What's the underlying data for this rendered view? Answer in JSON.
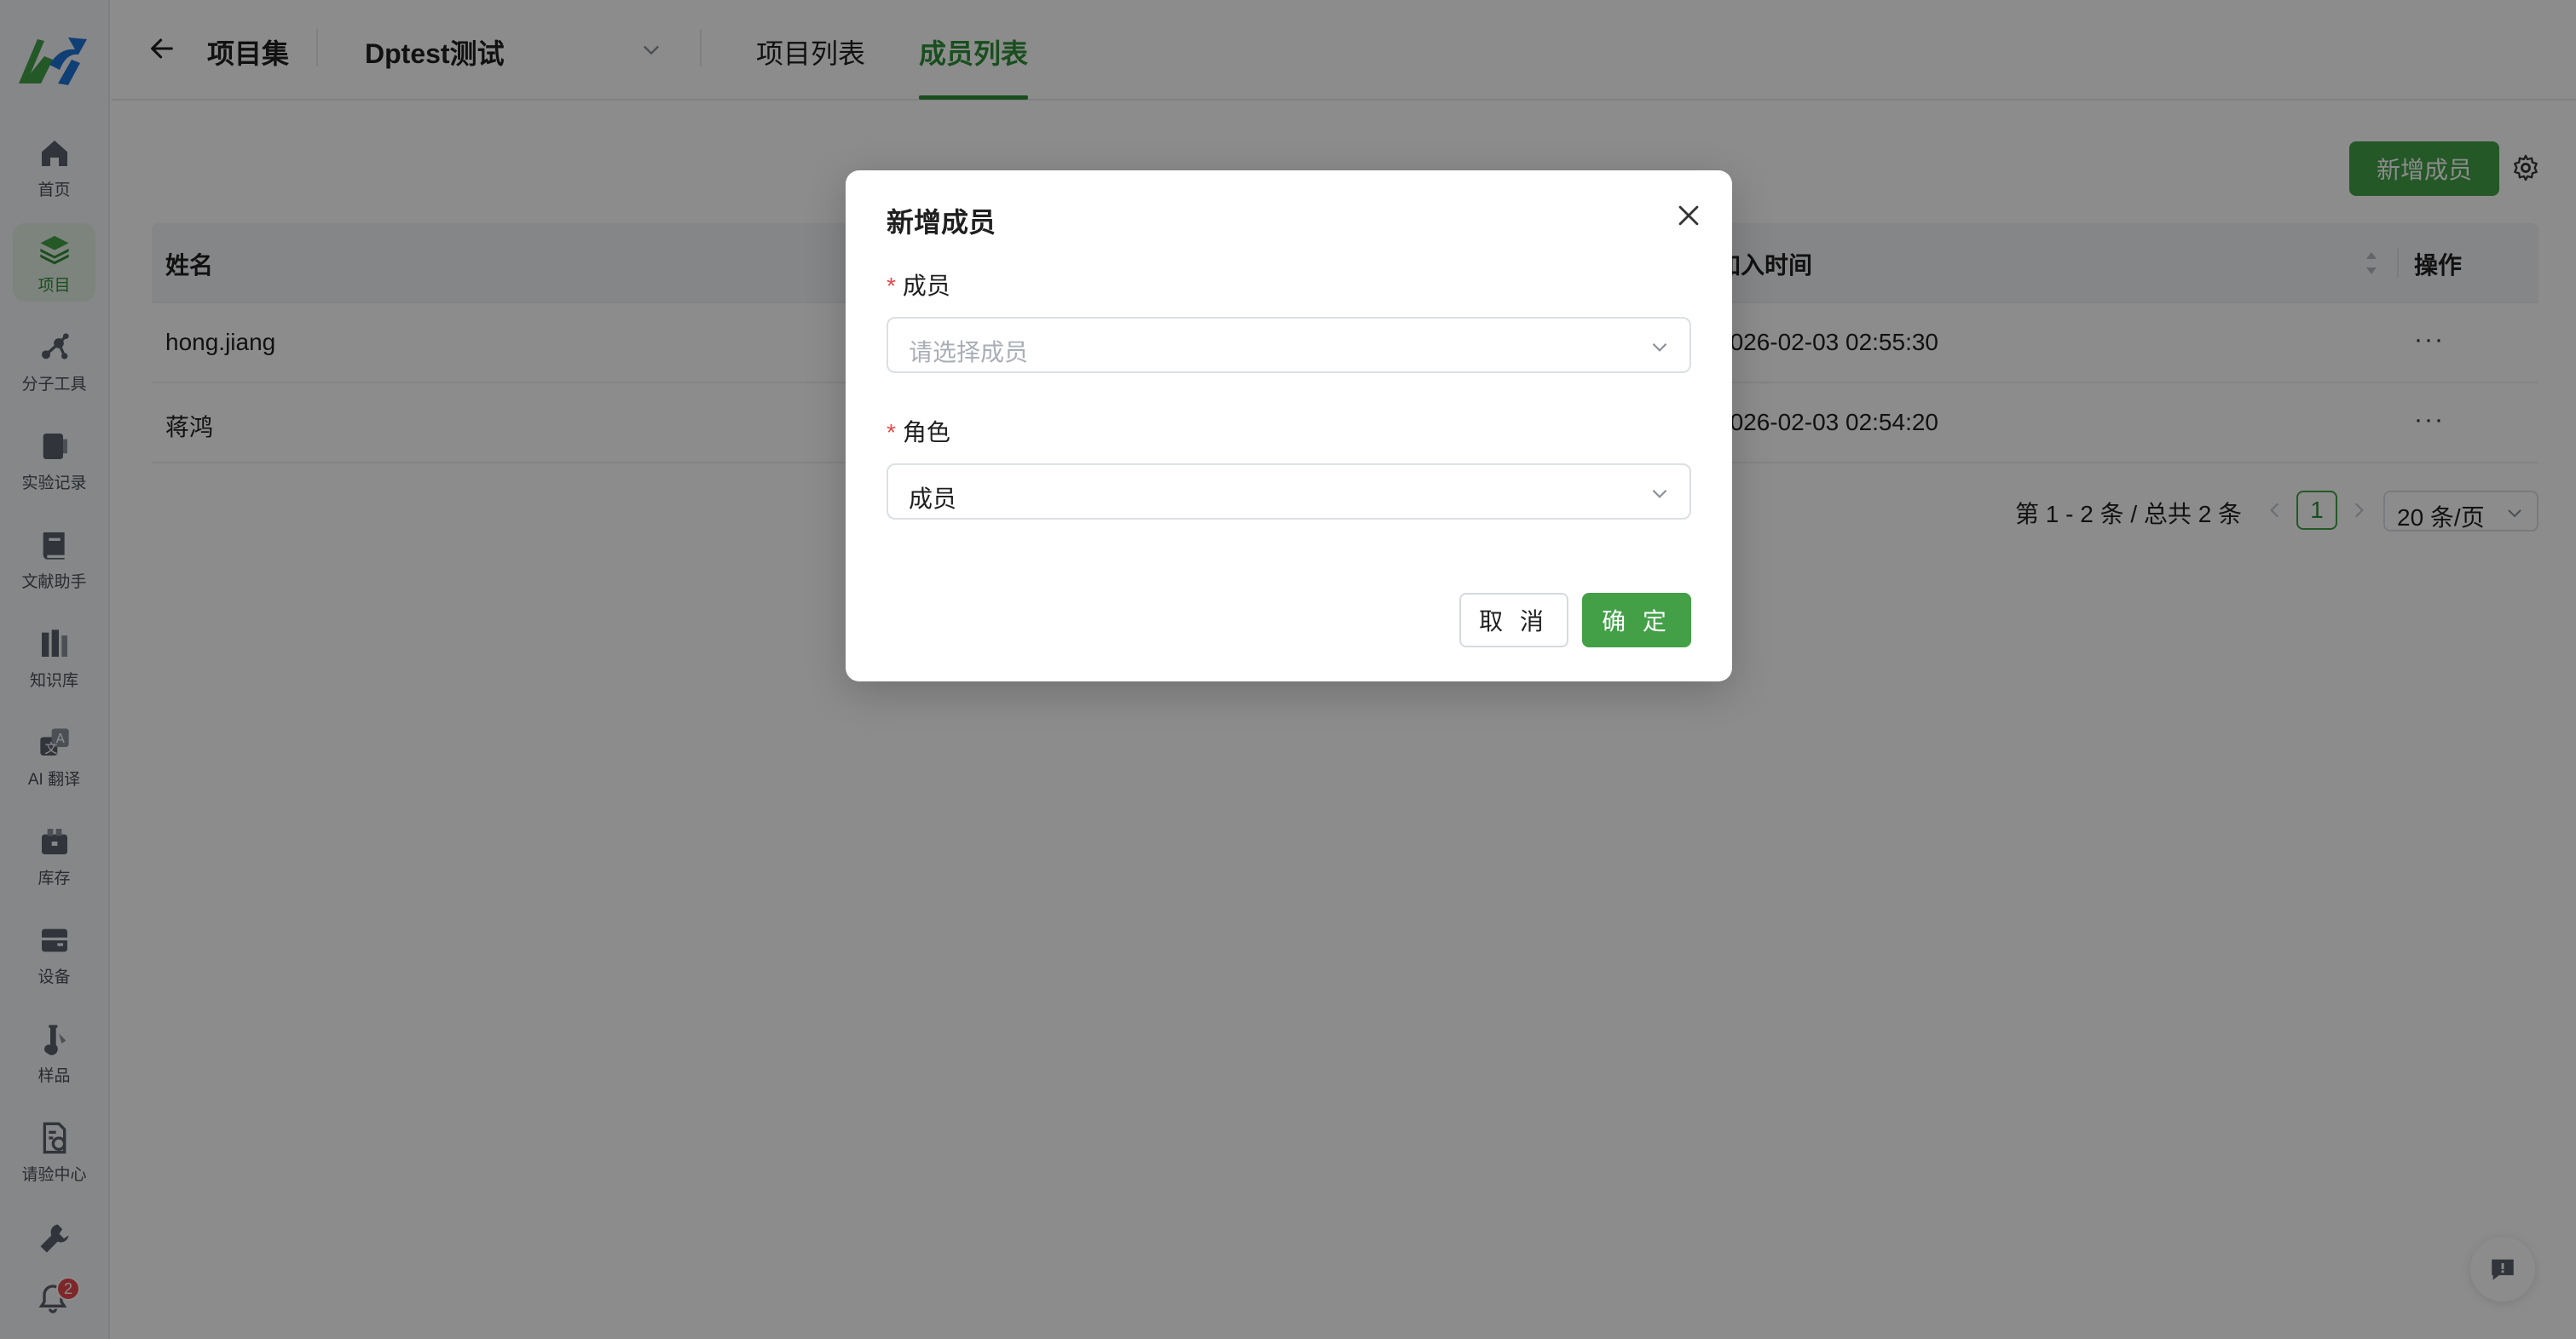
{
  "colors": {
    "brand_green": "#43a047",
    "active_green": "#2f8f37",
    "required_red": "#e5484d",
    "overlay": "rgba(0,0,0,0.45)"
  },
  "sidebar": {
    "items": [
      {
        "label": "首页",
        "icon": "home-icon"
      },
      {
        "label": "项目",
        "icon": "layers-icon",
        "active": true
      },
      {
        "label": "分子工具",
        "icon": "molecule-icon"
      },
      {
        "label": "实验记录",
        "icon": "notebook-icon"
      },
      {
        "label": "文献助手",
        "icon": "book-icon"
      },
      {
        "label": "知识库",
        "icon": "library-icon"
      },
      {
        "label": "AI 翻译",
        "icon": "translate-icon"
      },
      {
        "label": "库存",
        "icon": "inventory-icon"
      },
      {
        "label": "设备",
        "icon": "device-icon"
      },
      {
        "label": "样品",
        "icon": "sample-icon"
      },
      {
        "label": "请验中心",
        "icon": "request-icon"
      }
    ],
    "tools_icon": "tools-icon",
    "notifications": {
      "icon": "bell-icon",
      "count": "2"
    }
  },
  "header": {
    "title": "项目集",
    "project_select": {
      "value": "Dptest测试"
    },
    "tabs": [
      {
        "label": "项目列表",
        "active": false
      },
      {
        "label": "成员列表",
        "active": true
      }
    ]
  },
  "toolbar": {
    "add_member_label": "新增成员",
    "settings_icon": "gear-icon"
  },
  "table": {
    "columns": [
      "姓名",
      "加入时间",
      "操作"
    ],
    "rows": [
      {
        "name": "hong.jiang",
        "joined": "2026-02-03 02:55:30",
        "actions": "···"
      },
      {
        "name": "蒋鸿",
        "joined": "2026-02-03 02:54:20",
        "actions": "···"
      }
    ]
  },
  "pagination": {
    "total_text": "第 1 - 2 条 / 总共 2 条",
    "current_page": "1",
    "page_size": "20 条/页"
  },
  "modal": {
    "title": "新增成员",
    "member_field": {
      "required_mark": "*",
      "label": "成员",
      "placeholder": "请选择成员"
    },
    "role_field": {
      "required_mark": "*",
      "label": "角色",
      "value": "成员"
    },
    "cancel_label": "取 消",
    "ok_label": "确 定"
  }
}
